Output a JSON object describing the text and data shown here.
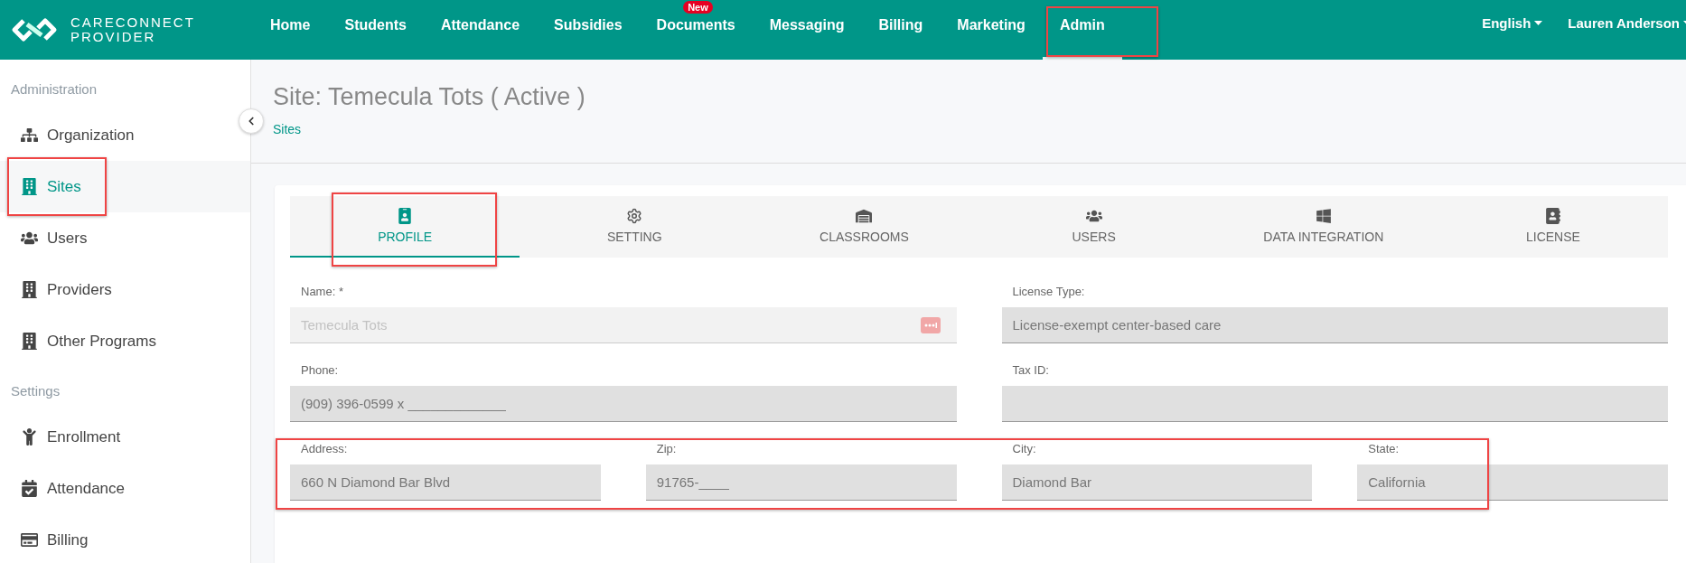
{
  "brand": {
    "line1": "CARECONNECT",
    "line2": "PROVIDER"
  },
  "nav": [
    {
      "label": "Home",
      "selected": false,
      "highlighted": false
    },
    {
      "label": "Students",
      "selected": false,
      "highlighted": false
    },
    {
      "label": "Attendance",
      "selected": false,
      "highlighted": false
    },
    {
      "label": "Subsidies",
      "selected": false,
      "highlighted": false
    },
    {
      "label": "Documents",
      "selected": false,
      "highlighted": false,
      "badge": "New"
    },
    {
      "label": "Messaging",
      "selected": false,
      "highlighted": false
    },
    {
      "label": "Billing",
      "selected": false,
      "highlighted": false
    },
    {
      "label": "Marketing",
      "selected": false,
      "highlighted": false
    },
    {
      "label": "Admin",
      "selected": true,
      "highlighted": true
    }
  ],
  "language": "English",
  "user": "Lauren Anderson",
  "sidebar": {
    "sections": [
      {
        "title": "Administration",
        "items": [
          {
            "label": "Organization",
            "selected": false,
            "highlighted": false
          },
          {
            "label": "Sites",
            "selected": true,
            "highlighted": true
          },
          {
            "label": "Users",
            "selected": false,
            "highlighted": false
          },
          {
            "label": "Providers",
            "selected": false,
            "highlighted": false
          },
          {
            "label": "Other Programs",
            "selected": false,
            "highlighted": false
          }
        ]
      },
      {
        "title": "Settings",
        "items": [
          {
            "label": "Enrollment",
            "selected": false,
            "highlighted": false
          },
          {
            "label": "Attendance",
            "selected": false,
            "highlighted": false
          },
          {
            "label": "Billing",
            "selected": false,
            "highlighted": false
          }
        ]
      }
    ]
  },
  "page": {
    "title": "Site: Temecula Tots ( Active )",
    "breadcrumb": "Sites"
  },
  "tabs": [
    {
      "label": "PROFILE",
      "selected": true,
      "highlighted": true
    },
    {
      "label": "SETTING",
      "selected": false,
      "highlighted": false
    },
    {
      "label": "CLASSROOMS",
      "selected": false,
      "highlighted": false
    },
    {
      "label": "USERS",
      "selected": false,
      "highlighted": false
    },
    {
      "label": "DATA INTEGRATION",
      "selected": false,
      "highlighted": false
    },
    {
      "label": "LICENSE",
      "selected": false,
      "highlighted": false
    }
  ],
  "form": {
    "rows": [
      {
        "highlighted": false,
        "fields": [
          {
            "label": "Name: *",
            "value": "Temecula Tots",
            "disabled": true
          },
          {
            "label": "License Type:",
            "value": "License-exempt center-based care",
            "disabled": false
          }
        ]
      },
      {
        "highlighted": false,
        "fields": [
          {
            "label": "Phone:",
            "value": "(909) 396-0599 x _____________",
            "disabled": false
          },
          {
            "label": "Tax ID:",
            "disabled": false
          }
        ]
      },
      {
        "highlighted": true,
        "fields": [
          {
            "label": "Address:",
            "value": "660 N Diamond Bar Blvd",
            "disabled": false
          },
          {
            "label": "Zip:",
            "value": "91765-____",
            "disabled": false
          },
          {
            "label": "City:",
            "value": "Diamond Bar",
            "disabled": false
          },
          {
            "label": "State:",
            "value": "California",
            "disabled": false
          }
        ]
      }
    ]
  }
}
